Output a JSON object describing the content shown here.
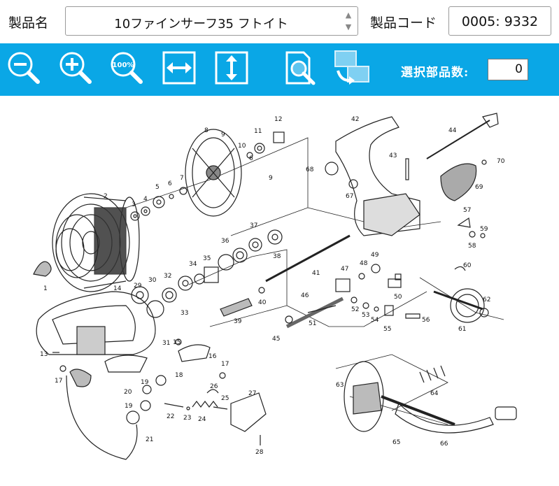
{
  "header": {
    "product_name_label": "製品名",
    "product_name_value": "10ファインサーフ35 フトイト",
    "spinner_up": "▲",
    "spinner_down": "▼",
    "product_code_label": "製品コード",
    "product_code_value": "0005: 9332"
  },
  "toolbar": {
    "background": "#0aa7e6",
    "buttons": [
      {
        "name": "zoom-out",
        "icon": "zoom-out-icon"
      },
      {
        "name": "zoom-in",
        "icon": "zoom-in-icon"
      },
      {
        "name": "zoom-100",
        "icon": "zoom-100-icon",
        "label": "100%"
      },
      {
        "name": "fit-width",
        "icon": "fit-width-icon"
      },
      {
        "name": "fit-height",
        "icon": "fit-height-icon"
      },
      {
        "name": "page-search",
        "icon": "page-search-icon"
      },
      {
        "name": "switch-view",
        "icon": "switch-view-icon"
      }
    ],
    "selected_count_label": "選択部品数:",
    "selected_count_value": "0"
  },
  "diagram": {
    "part_numbers": [
      "1",
      "2",
      "3",
      "4",
      "5",
      "6",
      "6",
      "7",
      "8",
      "9",
      "9",
      "10",
      "11",
      "12",
      "13",
      "14",
      "15",
      "16",
      "17",
      "17",
      "18",
      "19",
      "19",
      "20",
      "21",
      "22",
      "23",
      "24",
      "25",
      "26",
      "27",
      "28",
      "29",
      "30",
      "31",
      "32",
      "33",
      "34",
      "35",
      "36",
      "37",
      "38",
      "39",
      "40",
      "41",
      "42",
      "43",
      "44",
      "45",
      "46",
      "47",
      "48",
      "49",
      "50",
      "51",
      "52",
      "53",
      "54",
      "55",
      "56",
      "57",
      "58",
      "59",
      "60",
      "61",
      "62",
      "63",
      "64",
      "65",
      "66",
      "67",
      "68",
      "69",
      "70"
    ]
  }
}
